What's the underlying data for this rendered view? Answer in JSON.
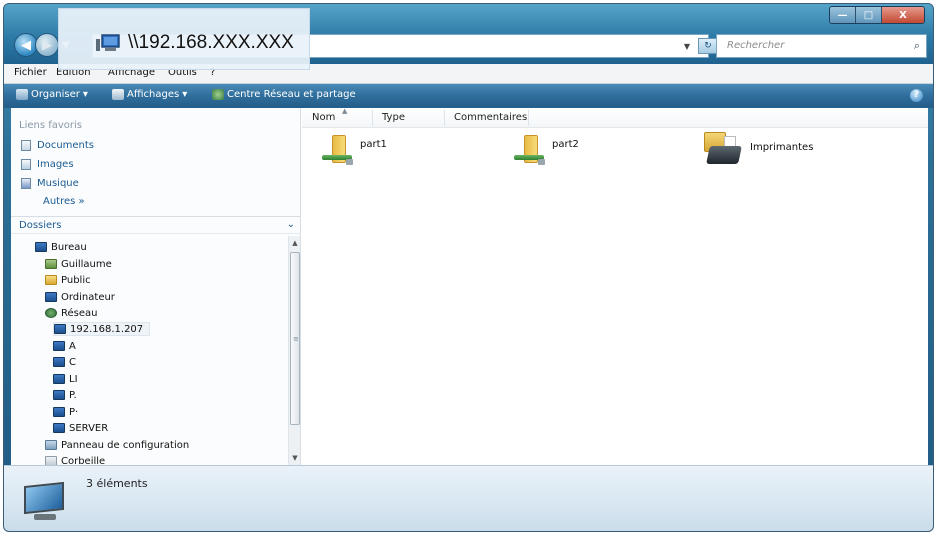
{
  "window": {
    "buttons": {
      "minimize": "—",
      "maximize": "□",
      "close": "X"
    }
  },
  "nav": {
    "back": "◀",
    "forward": "▶",
    "dropdown": "▼"
  },
  "address": {
    "value": "\\\\192.168.XXX.XXX"
  },
  "search": {
    "placeholder": "Rechercher",
    "icon": "⌕"
  },
  "menubar": {
    "items": [
      "Fichier",
      "Edition",
      "Affichage",
      "Outils",
      "?"
    ]
  },
  "toolbar": {
    "organize": "Organiser",
    "views": "Affichages",
    "network_center": "Centre Réseau et partage",
    "help": "?"
  },
  "favorites": {
    "header": "Liens favoris",
    "items": [
      "Documents",
      "Images",
      "Musique"
    ],
    "more": "Autres »"
  },
  "folders": {
    "header": "Dossiers",
    "tree": [
      {
        "label": "Bureau",
        "icon": "monitor"
      },
      {
        "label": "Guillaume",
        "icon": "user"
      },
      {
        "label": "Public",
        "icon": "folder"
      },
      {
        "label": "Ordinateur",
        "icon": "monitor"
      },
      {
        "label": "Réseau",
        "icon": "net"
      },
      {
        "label": "192.168.1.207",
        "icon": "monitor"
      },
      {
        "label": "A",
        "icon": "monitor"
      },
      {
        "label": "C",
        "icon": "monitor"
      },
      {
        "label": "LI",
        "icon": "monitor"
      },
      {
        "label": "P.",
        "icon": "monitor"
      },
      {
        "label": "P·",
        "icon": "monitor"
      },
      {
        "label": "SERVER",
        "icon": "monitor"
      },
      {
        "label": "Panneau de configuration",
        "icon": "panel"
      },
      {
        "label": "Corbeille",
        "icon": "bin"
      }
    ]
  },
  "columns": [
    "Nom",
    "Type",
    "Commentaires"
  ],
  "items": [
    {
      "label": "part1",
      "icon": "shared-folder"
    },
    {
      "label": "part2",
      "icon": "shared-folder"
    },
    {
      "label": "Imprimantes",
      "icon": "printer"
    }
  ],
  "status": {
    "count": "3 éléments"
  }
}
